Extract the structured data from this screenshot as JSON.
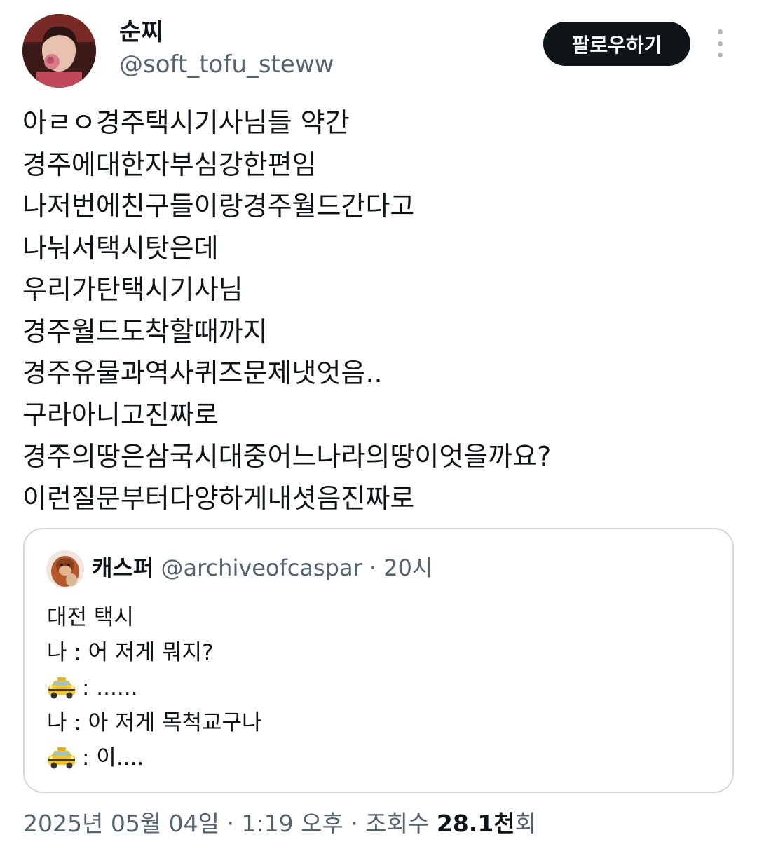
{
  "author": {
    "display_name": "순찌",
    "handle": "@soft_tofu_steww"
  },
  "follow_button": {
    "label": "팔로우하기"
  },
  "more_icon": "more-vertical-icon",
  "tweet": {
    "lines": [
      "아ㄹㅇ경주택시기사님들 약간",
      "경주에대한자부심강한편임",
      "나저번에친구들이랑경주월드간다고",
      "나눠서택시탓은데",
      "우리가탄택시기사님",
      "경주월드도착할때까지",
      "경주유물과역사퀴즈문제냇엇음..",
      "구라아니고진짜로",
      "경주의땅은삼국시대중어느나라의땅이엇을까요?",
      "이런질문부터다양하게내셧음진짜로"
    ]
  },
  "quote": {
    "display_name": "캐스퍼",
    "handle": "@archiveofcaspar",
    "separator": "·",
    "time": "20시",
    "lines": [
      {
        "icon": "",
        "text": "대전 택시"
      },
      {
        "icon": "",
        "text": "나 : 어 저게 뭐지?"
      },
      {
        "icon": "taxi-icon",
        "text": ": ......"
      },
      {
        "icon": "",
        "text": "나 : 아 저게 목척교구나"
      },
      {
        "icon": "taxi-icon",
        "text": ": 이...."
      }
    ]
  },
  "meta": {
    "datetime": "2025년 05월 04일 · 1:19 오후 · 조회수 ",
    "views_count": "28.1천",
    "views_suffix": "회"
  }
}
